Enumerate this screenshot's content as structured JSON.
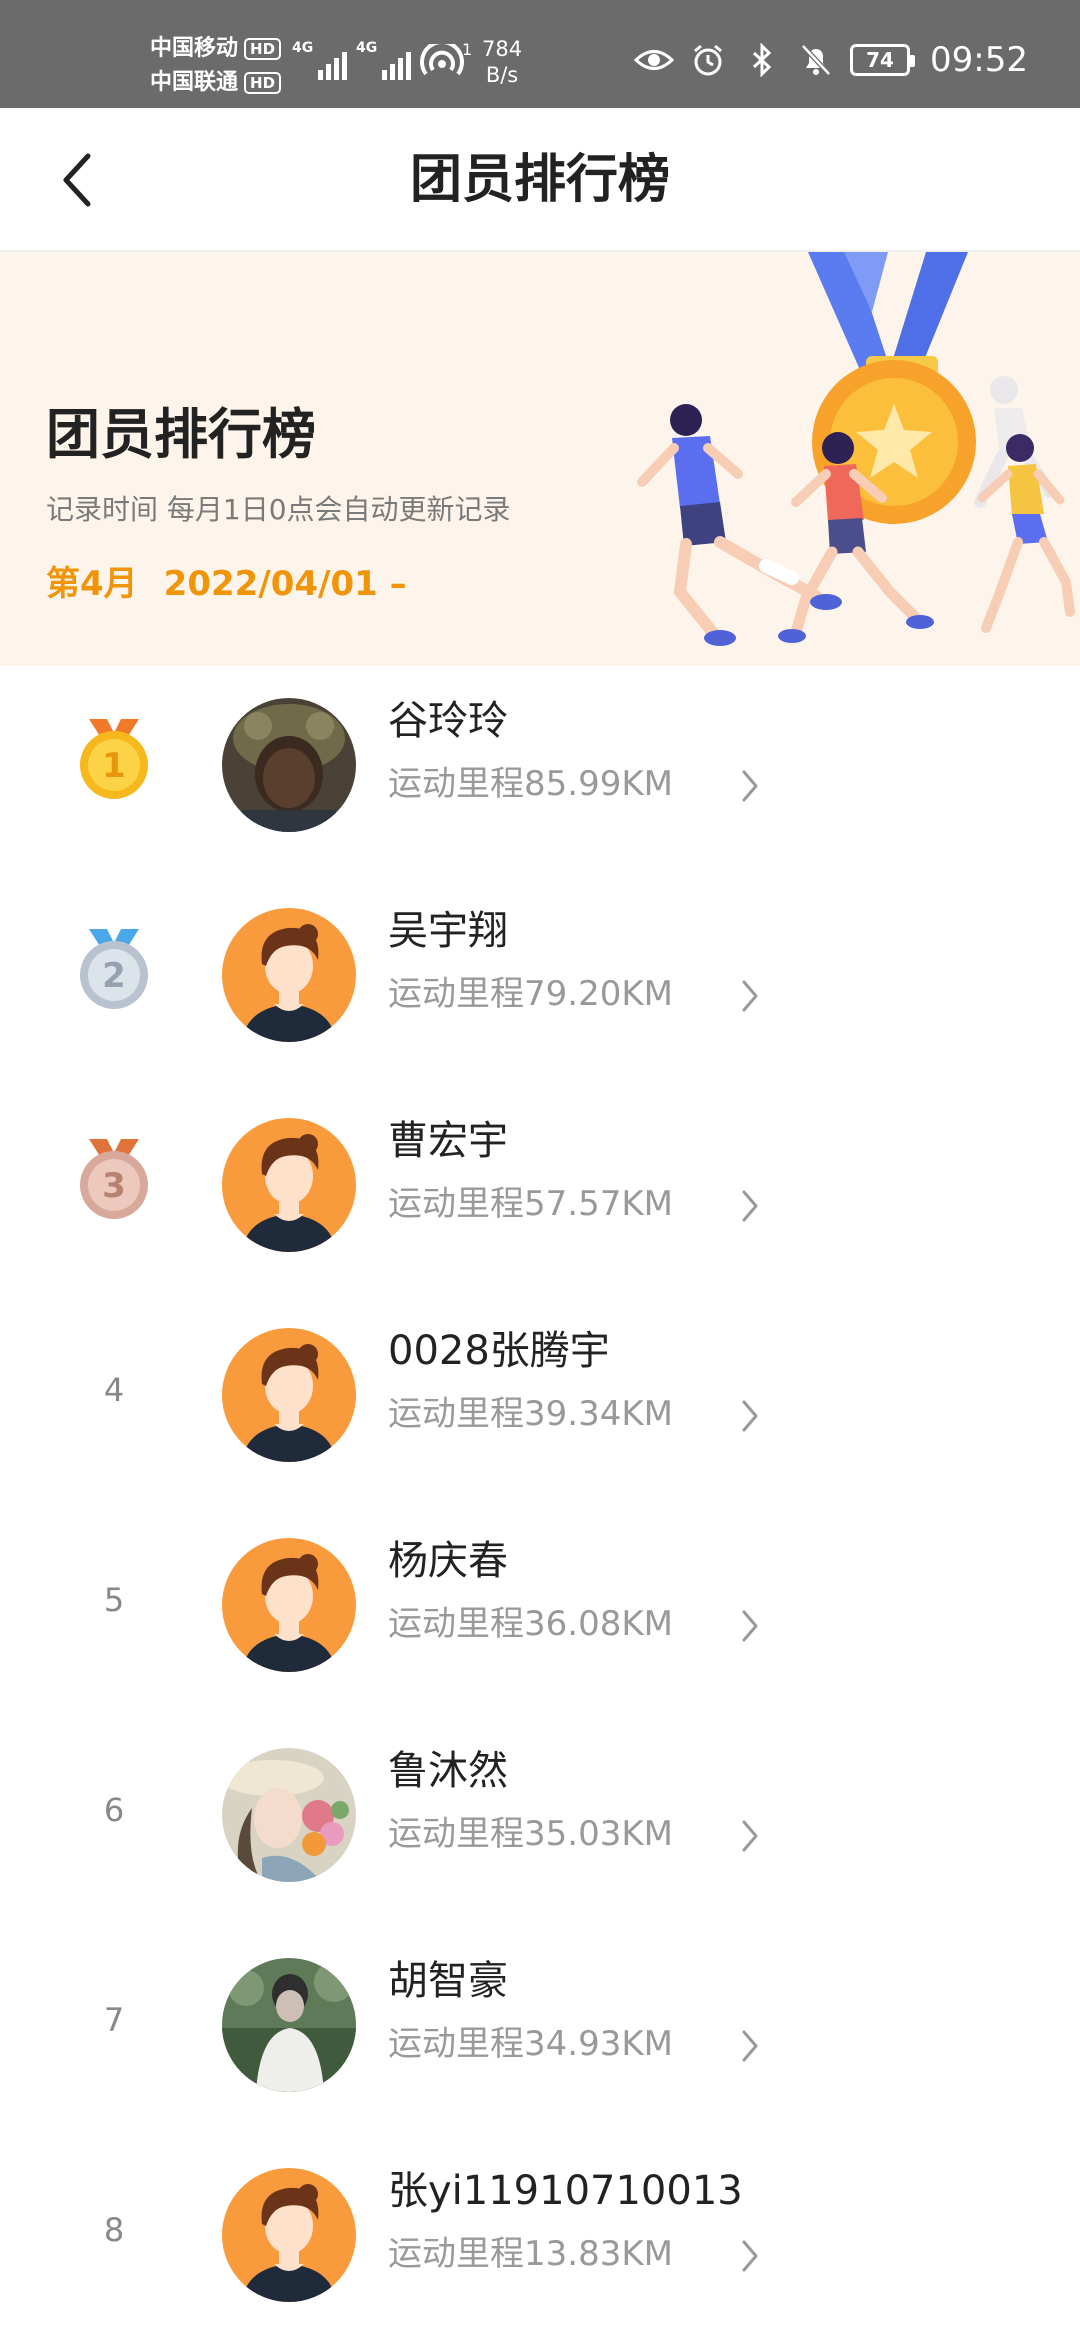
{
  "status_bar": {
    "carrier1": "中国移动",
    "carrier2": "中国联通",
    "hd_badge": "HD",
    "network1": "4G",
    "network2": "4G",
    "wifi_count": "1",
    "speed_value": "784",
    "speed_unit": "B/s",
    "battery": "74",
    "time": "09:52"
  },
  "navbar": {
    "title": "团员排行榜"
  },
  "banner": {
    "title": "团员排行榜",
    "description": "记录时间 每月1日0点会自动更新记录",
    "month": "第4月",
    "date_range": "2022/04/01 –"
  },
  "colors": {
    "accent": "#f0950a",
    "banner_bg": "#fdf5ec",
    "avatar_orange": "#f99a3c"
  },
  "leaderboard": [
    {
      "rank": "1",
      "medal": "gold",
      "name": "谷玲玲",
      "mileage": "运动里程85.99KM",
      "avatar": "photo-child"
    },
    {
      "rank": "2",
      "medal": "silver",
      "name": "吴宇翔",
      "mileage": "运动里程79.20KM",
      "avatar": "default-avatar"
    },
    {
      "rank": "3",
      "medal": "bronze",
      "name": "曹宏宇",
      "mileage": "运动里程57.57KM",
      "avatar": "default-avatar"
    },
    {
      "rank": "4",
      "medal": "",
      "name": "0028张腾宇",
      "mileage": "运动里程39.34KM",
      "avatar": "default-avatar"
    },
    {
      "rank": "5",
      "medal": "",
      "name": "杨庆春",
      "mileage": "运动里程36.08KM",
      "avatar": "default-avatar"
    },
    {
      "rank": "6",
      "medal": "",
      "name": "鲁沐然",
      "mileage": "运动里程35.03KM",
      "avatar": "photo-flowers"
    },
    {
      "rank": "7",
      "medal": "",
      "name": "胡智豪",
      "mileage": "运动里程34.93KM",
      "avatar": "photo-outdoor"
    },
    {
      "rank": "8",
      "medal": "",
      "name": "张yi11910710013",
      "mileage": "运动里程13.83KM",
      "avatar": "default-avatar"
    }
  ]
}
